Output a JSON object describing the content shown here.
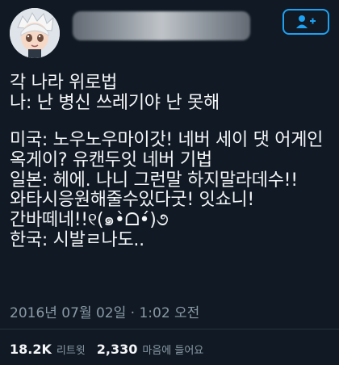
{
  "profile": {
    "avatar_icon": "anime-avatar-icon",
    "follow_icon": "follow-user-plus-icon"
  },
  "tweet": {
    "lines": [
      "각 나라 위로법",
      "나: 난 병신 쓰레기야 난 못해",
      "",
      "미국: 노우노우마이갓! 네버 세이 댓 어게인",
      "옥게이? 유캔두잇 네버 기법",
      "일본: 헤에. 나니 그런말 하지말라데수!!",
      "와타시응원해줄수있다굿! 잇쇼니!",
      "간바떼네!!୧(๑•̀ᗝ•́)૭",
      "한국: 시발ㄹ나도.."
    ],
    "timestamp": "2016년 07월 02일 · 1:02 오전"
  },
  "stats": {
    "retweets_count": "18.2K",
    "retweets_label": "리트윗",
    "likes_count": "2,330",
    "likes_label": "마음에 들어요"
  },
  "colors": {
    "background": "#111a24",
    "text": "#f3f5f7",
    "muted": "#8899a6",
    "accent": "#1da1f2"
  }
}
